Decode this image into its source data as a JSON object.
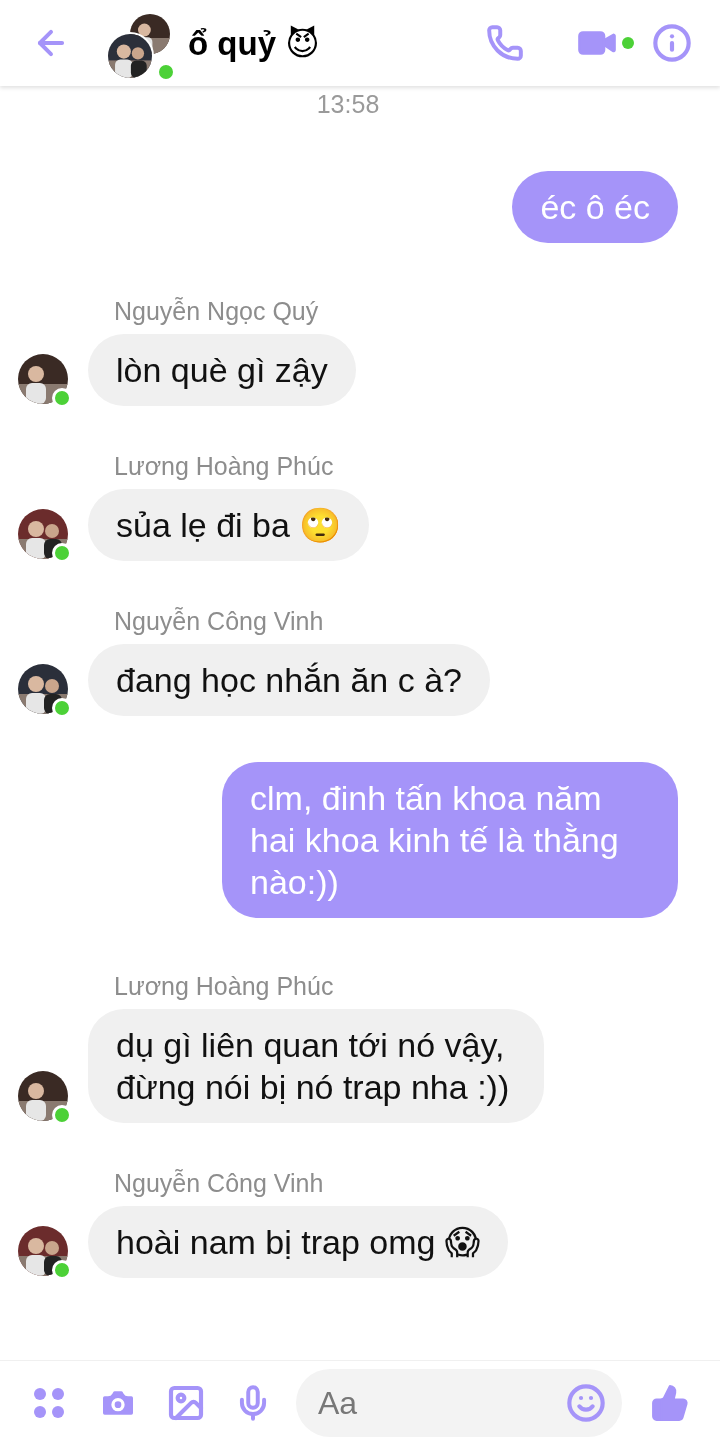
{
  "header": {
    "title": "ổ quỷ 😈",
    "online": true
  },
  "time": "13:58",
  "messages": [
    {
      "kind": "outgoing",
      "text": "éc ô éc"
    },
    {
      "kind": "incoming",
      "sender": "Nguyễn Ngọc Quý",
      "text": "lòn què gì zậy",
      "online": true
    },
    {
      "kind": "incoming",
      "sender": "Lương Hoàng Phúc",
      "text": "sủa lẹ đi ba 🙄",
      "online": true
    },
    {
      "kind": "incoming",
      "sender": "Nguyễn Công Vinh",
      "text": "đang học nhắn ăn c à?",
      "online": true
    },
    {
      "kind": "outgoing",
      "text": "clm, đinh tấn khoa năm hai khoa kinh tế là thằng nào:))"
    },
    {
      "kind": "incoming",
      "sender": "Lương Hoàng Phúc",
      "text": "dụ gì liên quan tới nó vậy, đừng nói bị nó trap nha :))",
      "online": true
    },
    {
      "kind": "incoming",
      "sender": "Nguyễn Công Vinh",
      "text": "hoài nam bị trap omg 😱",
      "online": true
    }
  ],
  "composer": {
    "placeholder": "Aa"
  }
}
